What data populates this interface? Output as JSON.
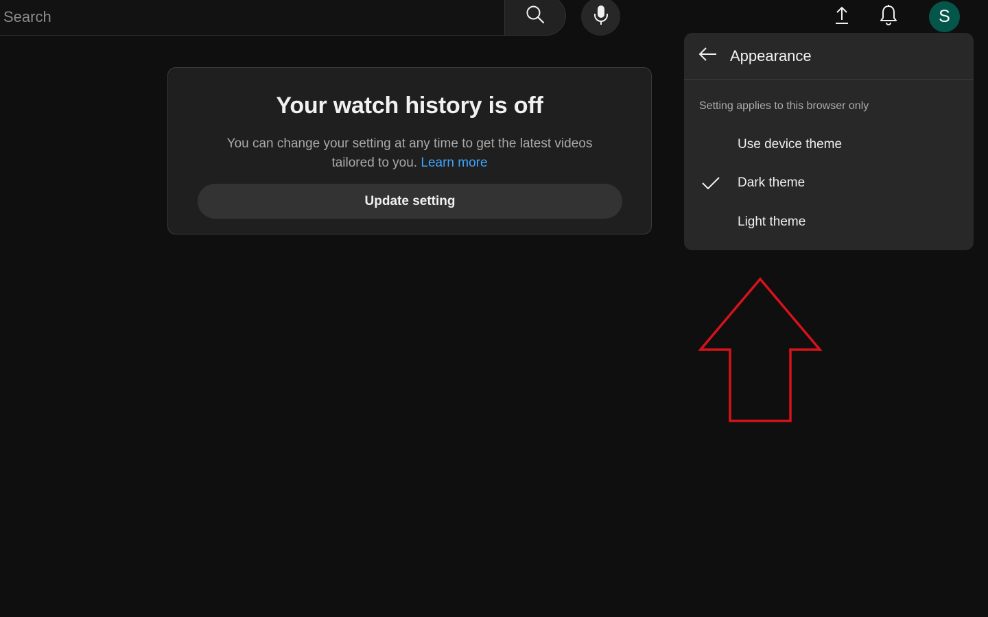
{
  "header": {
    "search_placeholder": "Search",
    "search_icon": "search-icon",
    "mic_icon": "microphone-icon",
    "upload_icon": "upload-icon",
    "notifications_icon": "bell-icon",
    "avatar_letter": "S",
    "avatar_color": "#04564a"
  },
  "history_card": {
    "title": "Your watch history is off",
    "description": "You can change your setting at any time to get the latest videos tailored to you.",
    "learn_more": "Learn more",
    "button_label": "Update setting"
  },
  "appearance_menu": {
    "title": "Appearance",
    "note": "Setting applies to this browser only",
    "options": [
      {
        "label": "Use device theme",
        "selected": false
      },
      {
        "label": "Dark theme",
        "selected": true
      },
      {
        "label": "Light theme",
        "selected": false
      }
    ]
  },
  "annotation": {
    "arrow_color": "#d8121a",
    "arrow_direction": "up"
  },
  "colors": {
    "background": "#0f0f0f",
    "link": "#3ea6ff"
  }
}
